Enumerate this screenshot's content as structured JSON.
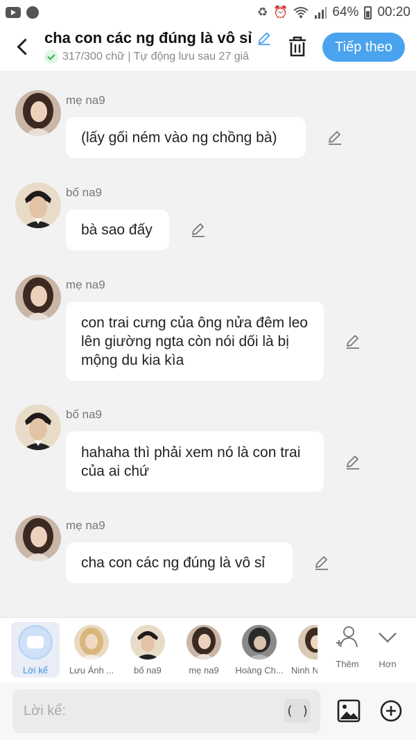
{
  "status_bar": {
    "battery_pct": "64%",
    "time": "00:20",
    "icons": [
      "youtube-icon",
      "globe-icon",
      "recycle-icon",
      "alarm-icon",
      "wifi-icon",
      "signal-icon",
      "battery-icon"
    ]
  },
  "header": {
    "title": "cha con các ng đúng là vô sỉ",
    "subtitle": "317/300 chữ | Tự động lưu sau 27 giâ",
    "next_label": "Tiếp theo",
    "accent_color": "#4aa3ee"
  },
  "messages": [
    {
      "sender": "mẹ na9",
      "text": "(lấy gối ném vào ng chồng bà)"
    },
    {
      "sender": "bố na9",
      "text": "bà sao đấy"
    },
    {
      "sender": "mẹ na9",
      "text": "con trai cưng của ông nửa đêm leo lên giường ngta còn nói dối là bị mộng du kia kìa"
    },
    {
      "sender": "bố na9",
      "text": "hahaha thì phải xem nó là con trai của ai chứ"
    },
    {
      "sender": "mẹ na9",
      "text": "cha con các ng đúng là vô sỉ"
    }
  ],
  "characters": [
    {
      "label": "Lời kể",
      "active": true
    },
    {
      "label": "Lưu Ánh ..."
    },
    {
      "label": "bố na9"
    },
    {
      "label": "mẹ na9"
    },
    {
      "label": "Hoàng Ch..."
    },
    {
      "label": "Ninh N"
    }
  ],
  "tools": {
    "add_label": "Thêm",
    "more_label": "Hơn"
  },
  "input": {
    "placeholder": "Lời kể:",
    "paren_label": "( )"
  }
}
